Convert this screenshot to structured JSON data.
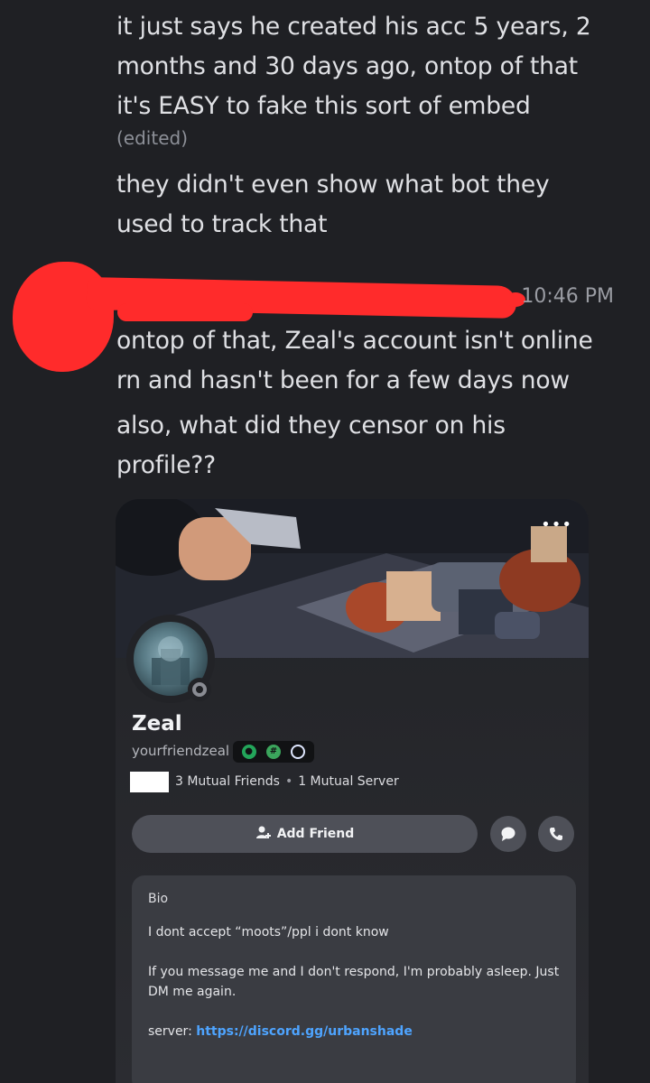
{
  "message1": {
    "lines": [
      "it just says he created his acc 5 years, 2",
      "months and 30 days ago, ontop of that",
      "it's EASY to fake this sort of embed"
    ],
    "edited_label": "(edited)",
    "lines2": [
      "they didn't even show what bot they",
      "used to track that"
    ]
  },
  "message2": {
    "timestamp": "10:46 PM",
    "lines": [
      "ontop of that, Zeal's account isn't online",
      "rn and hasn't been for a few days now"
    ],
    "lines2": [
      "also, what did they censor on his",
      "profile??"
    ]
  },
  "profile": {
    "display_name": "Zeal",
    "username": "yourfriendzeal",
    "mutual_friends": "3 Mutual Friends",
    "separator": "•",
    "mutual_servers": "1 Mutual Server",
    "add_friend_label": "Add Friend",
    "more_label": "•••",
    "bio": {
      "title": "Bio",
      "line1": "I dont accept “moots”/ppl i dont know",
      "line2": "If you message me and I don't respond, I'm probably asleep. Just",
      "line3": "DM me again.",
      "server_label": "server: ",
      "server_link": "https://discord.gg/urbanshade"
    }
  },
  "colors": {
    "background": "#1f2024",
    "redaction": "#ff2b2b",
    "link": "#4ea4ff",
    "button": "#4e5058"
  }
}
